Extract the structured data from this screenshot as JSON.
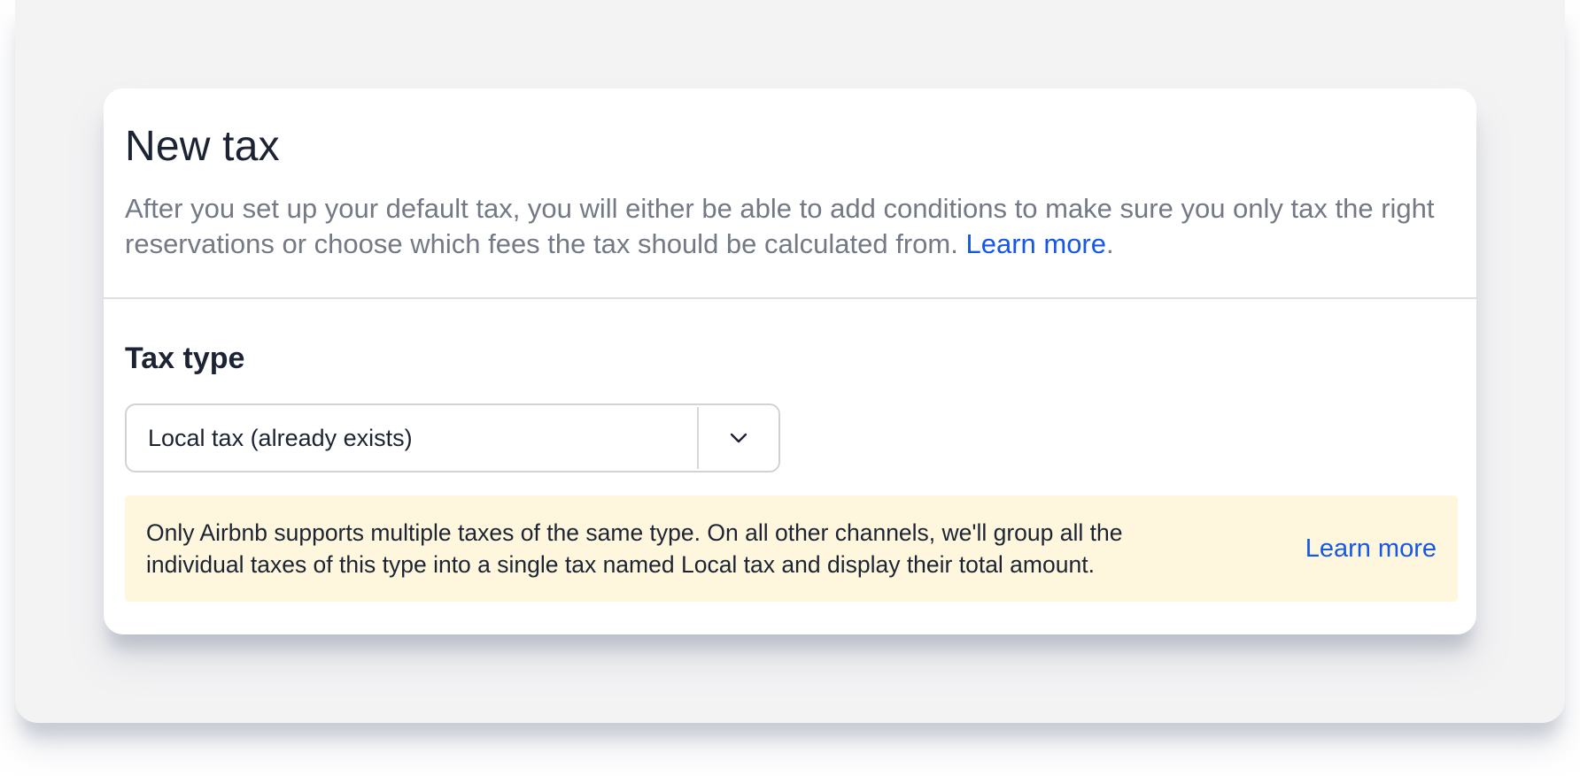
{
  "modal": {
    "title": "New tax",
    "description": "After you set up your default tax, you will either be able to add conditions to make sure you only tax the right reservations or choose which fees the tax should be calculated from.",
    "description_link": "Learn more",
    "description_suffix": "."
  },
  "tax_type": {
    "label": "Tax type",
    "selected_value": "Local tax (already exists)",
    "dropdown_icon": "chevron-down-icon"
  },
  "notice": {
    "text": "Only Airbnb supports multiple taxes of the same type. On all other channels, we'll group all the individual taxes of this type into a single tax named Local tax and display their total amount.",
    "link": "Learn more",
    "background_color": "#fef7dd"
  },
  "colors": {
    "link": "#1557e6",
    "heading": "#1c2333",
    "muted_text": "#737985"
  }
}
